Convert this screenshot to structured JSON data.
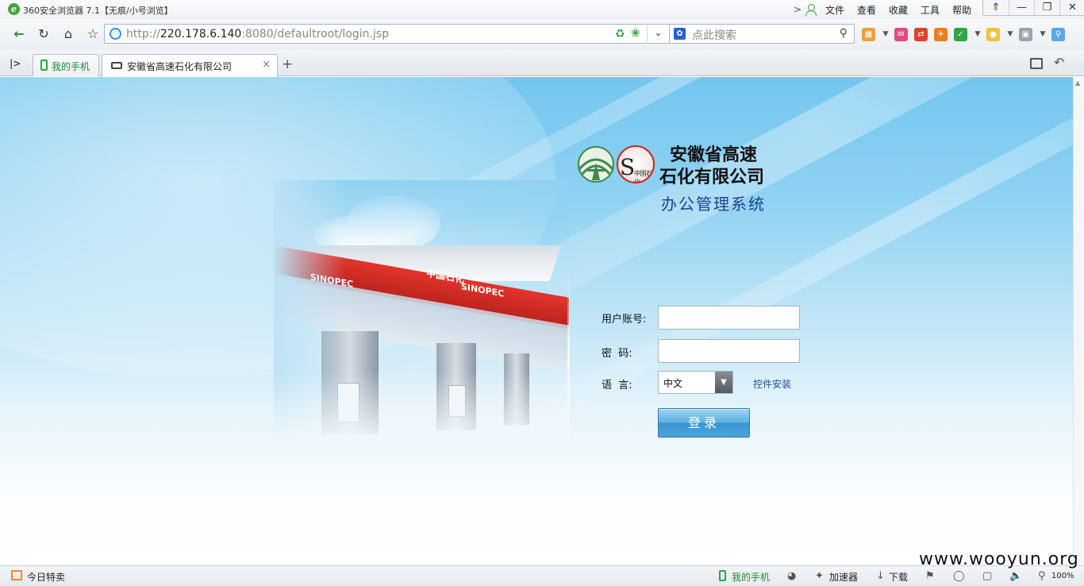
{
  "window": {
    "title": "360安全浏览器 7.1【无痕/小号浏览】",
    "menu": [
      "文件",
      "查看",
      "收藏",
      "工具",
      "帮助"
    ],
    "controls": [
      "⇑",
      "—",
      "❐",
      "✕"
    ]
  },
  "addressbar": {
    "url_prefix": "http://",
    "url_host": "220.178.6.140",
    "url_rest": ":8080/defaultroot/login.jsp",
    "search_placeholder": "点此搜索"
  },
  "tabs": {
    "phone_tab": "我的手机",
    "active_tab": "安徽省高速石化有限公司",
    "close": "×",
    "new": "+"
  },
  "page": {
    "station_band_cn": "中国石化",
    "station_band_en": "SINOPEC",
    "logo_text": "中国石化",
    "company_line1": "安徽省高速",
    "company_line2": "石化有限公司",
    "system_name": "办公管理系统",
    "form": {
      "username_label": "用户账号:",
      "username_value": "",
      "password_label": "密  码:",
      "password_value": "",
      "language_label": "语  言:",
      "language_value": "中文",
      "plugin_link": "控件安装",
      "login_button": "登录"
    }
  },
  "statusbar": {
    "today_deals": "今日特卖",
    "my_phone": "我的手机",
    "accelerator": "加速器",
    "download": "下载",
    "zoom": "100%"
  },
  "watermark": "www.wooyun.org",
  "colors": {
    "accent_green": "#2ea644",
    "brand_red": "#c92a23",
    "system_blue": "#1d3f91",
    "login_button": "#4ba4da"
  }
}
